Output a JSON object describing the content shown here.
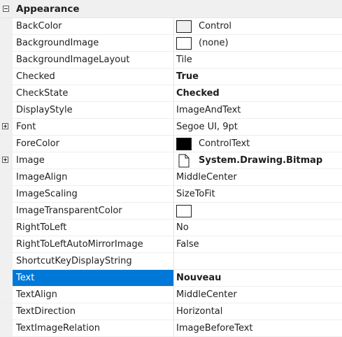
{
  "category": {
    "label": "Appearance"
  },
  "rows": [
    {
      "name": "BackColor",
      "value": "Control",
      "swatch": "#f0f0f0"
    },
    {
      "name": "BackgroundImage",
      "value": "(none)",
      "swatch": "#ffffff"
    },
    {
      "name": "BackgroundImageLayout",
      "value": "Tile"
    },
    {
      "name": "Checked",
      "value": "True",
      "bold": true
    },
    {
      "name": "CheckState",
      "value": "Checked",
      "bold": true
    },
    {
      "name": "DisplayStyle",
      "value": "ImageAndText"
    },
    {
      "name": "Font",
      "value": "Segoe UI, 9pt",
      "expandable": true
    },
    {
      "name": "ForeColor",
      "value": "ControlText",
      "swatch": "#000000"
    },
    {
      "name": "Image",
      "value": "System.Drawing.Bitmap",
      "bold": true,
      "expandable": true,
      "icon": "bitmap-icon"
    },
    {
      "name": "ImageAlign",
      "value": "MiddleCenter"
    },
    {
      "name": "ImageScaling",
      "value": "SizeToFit"
    },
    {
      "name": "ImageTransparentColor",
      "value": "",
      "swatch": "#ffffff"
    },
    {
      "name": "RightToLeft",
      "value": "No"
    },
    {
      "name": "RightToLeftAutoMirrorImage",
      "value": "False"
    },
    {
      "name": "ShortcutKeyDisplayString",
      "value": ""
    },
    {
      "name": "Text",
      "value": "Nouveau",
      "bold": true,
      "selected": true
    },
    {
      "name": "TextAlign",
      "value": "MiddleCenter"
    },
    {
      "name": "TextDirection",
      "value": "Horizontal"
    },
    {
      "name": "TextImageRelation",
      "value": "ImageBeforeText"
    }
  ],
  "colors": {
    "selection": "#0078d7",
    "gutter": "#f0f0f0"
  }
}
